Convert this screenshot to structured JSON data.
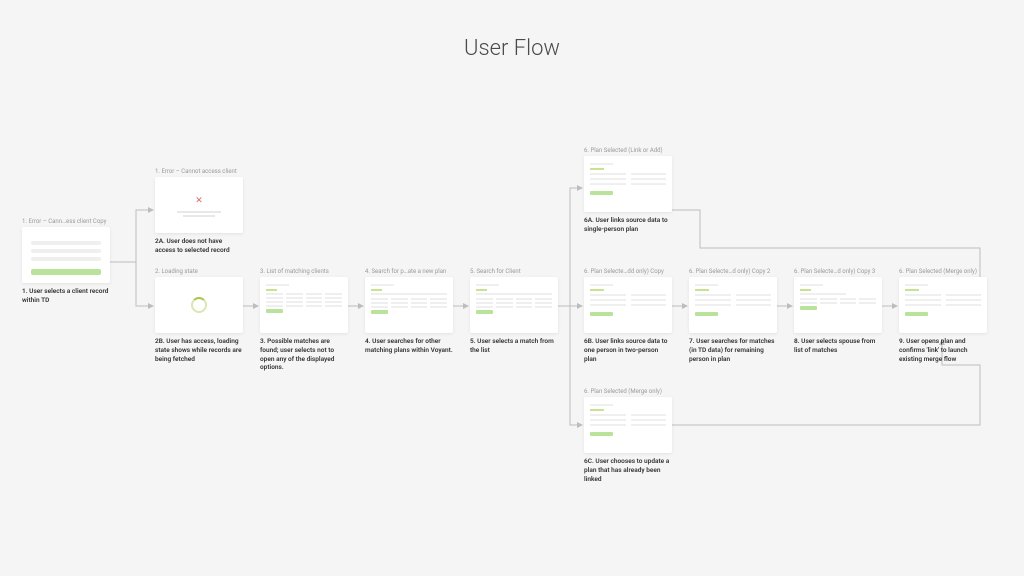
{
  "title": "User Flow",
  "nodes": {
    "n1": {
      "frame_label": "1. Error – Cann…ess client Copy",
      "caption": "1. User selects a client record within TD"
    },
    "n2a_frame": {
      "frame_label": "1. Error – Cannot access client",
      "caption": "2A. User does not have access to selected record"
    },
    "n2b_frame": {
      "frame_label": "2. Loading state",
      "caption": "2B. User has access, loading state shows while records are being fetched"
    },
    "n3": {
      "frame_label": "3. List of matching clients",
      "caption": "3. Possible matches are found; user selects not to open any of the displayed options."
    },
    "n4": {
      "frame_label": "4. Search for p…ate a new plan",
      "caption": "4. User searches for other matching plans within Voyant."
    },
    "n5": {
      "frame_label": "5. Search for Client",
      "caption": "5. User selects a match from the list"
    },
    "n6a": {
      "frame_label": "6. Plan Selected (Link or Add)",
      "caption": "6A. User links source data to single-person plan"
    },
    "n6b": {
      "frame_label": "6. Plan Selecte…dd only) Copy",
      "caption": "6B. User links source data to one person in two-person plan"
    },
    "n6c": {
      "frame_label": "6. Plan Selected (Merge only)",
      "caption": "6C. User chooses to update a plan that has already been linked"
    },
    "n7": {
      "frame_label": "6. Plan Selecte…d only) Copy 2",
      "caption": "7. User searches for matches (in TD data) for remaining person in plan"
    },
    "n8": {
      "frame_label": "6. Plan Selecte…d only) Copy 3",
      "caption": "8. User selects spouse from list of matches"
    },
    "n9": {
      "frame_label": "6. Plan Selected (Merge only)",
      "caption": "9. User opens plan and confirms 'link' to launch existing merge flow"
    }
  }
}
